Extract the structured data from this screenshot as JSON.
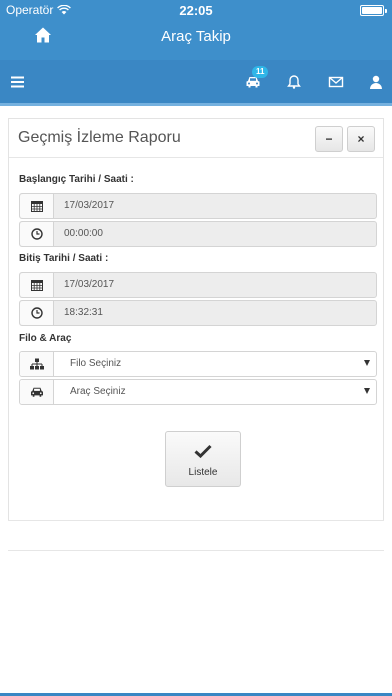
{
  "status_bar": {
    "carrier": "Operatör",
    "time": "22:05"
  },
  "header": {
    "title": "Araç Takip"
  },
  "navbar": {
    "vehicle_badge": "11"
  },
  "panel": {
    "title": "Geçmiş İzleme Raporu",
    "minimize_label": "−",
    "close_label": "×"
  },
  "start": {
    "label": "Başlangıç Tarihi / Saati :",
    "date": "17/03/2017",
    "time": "00:00:00"
  },
  "end": {
    "label": "Bitiş Tarihi / Saati :",
    "date": "17/03/2017",
    "time": "18:32:31"
  },
  "fleet": {
    "label": "Filo & Araç",
    "fleet_select": "Filo Seçiniz",
    "vehicle_select": "Araç Seçiniz"
  },
  "actions": {
    "list_label": "Listele"
  },
  "colors": {
    "primary": "#3e8fcb",
    "navbar": "#3a87c4",
    "badge": "#2fb6e8"
  },
  "icons": [
    "home-icon",
    "menu-icon",
    "car-icon",
    "bell-icon",
    "envelope-icon",
    "user-icon",
    "calendar-icon",
    "clock-icon",
    "sitemap-icon",
    "check-icon"
  ]
}
